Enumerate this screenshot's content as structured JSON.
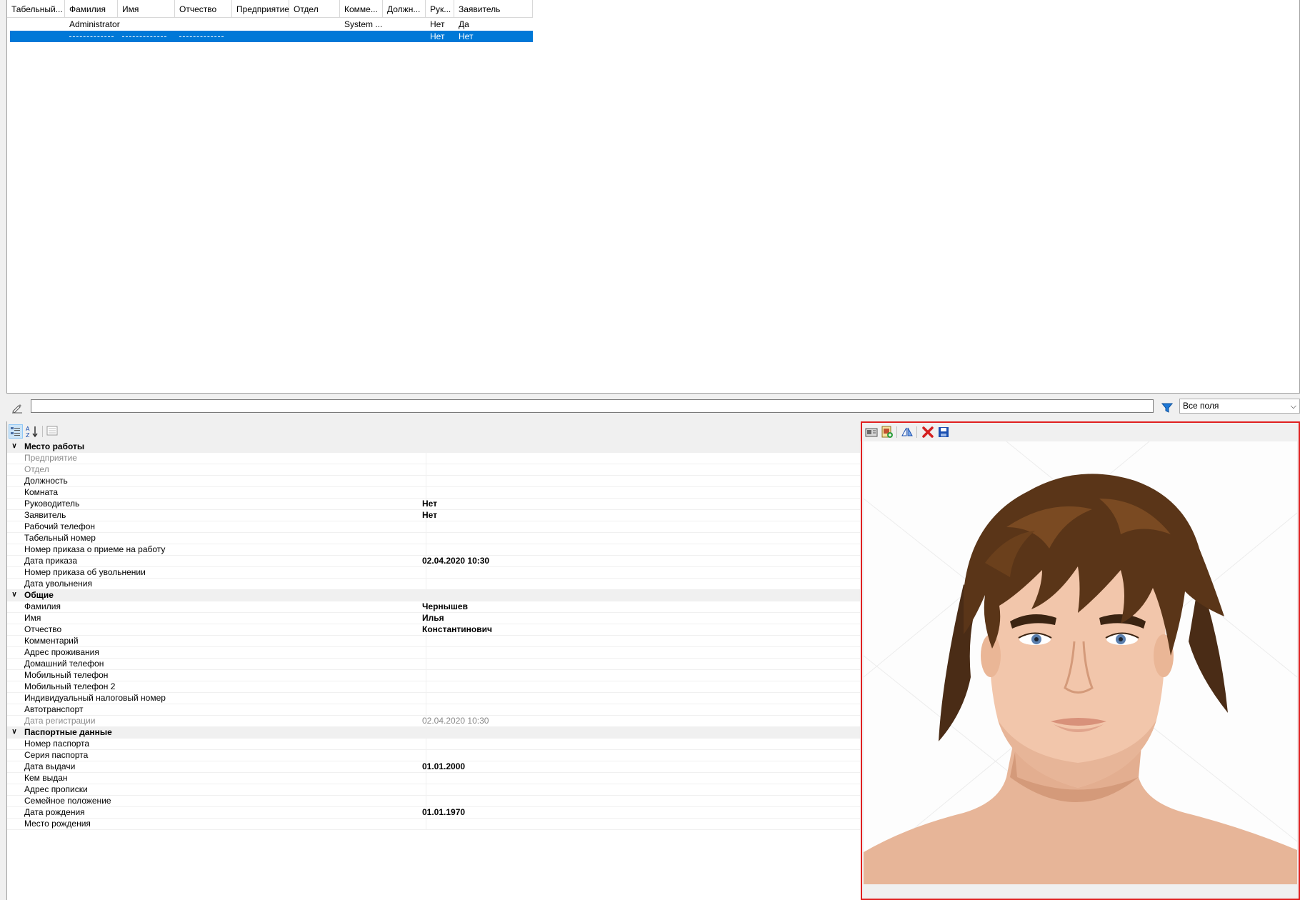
{
  "grid": {
    "columns": [
      "Табельный...",
      "Фамилия",
      "Имя",
      "Отчество",
      "Предприятие",
      "Отдел",
      "Комме...",
      "Должн...",
      "Рук...",
      "Заявитель"
    ],
    "rows": [
      {
        "tabnum": "",
        "lastname": "Administrator",
        "firstname": "",
        "middlename": "",
        "company": "",
        "dept": "",
        "comment": "System ...",
        "position": "",
        "manager": "Нет",
        "applicant": "Да"
      },
      {
        "tabnum": "",
        "lastname": "",
        "firstname": "",
        "middlename": "",
        "company": "",
        "dept": "",
        "comment": "",
        "position": "",
        "manager": "Нет",
        "applicant": "Нет"
      }
    ]
  },
  "search": {
    "value": "",
    "field_select": "Все поля"
  },
  "props": {
    "categories": [
      {
        "title": "Место работы",
        "items": [
          {
            "name": "Предприятие",
            "value": "",
            "disabled": true
          },
          {
            "name": "Отдел",
            "value": "",
            "disabled": true
          },
          {
            "name": "Должность",
            "value": ""
          },
          {
            "name": "Комната",
            "value": ""
          },
          {
            "name": "Руководитель",
            "value": "Нет"
          },
          {
            "name": "Заявитель",
            "value": "Нет"
          },
          {
            "name": "Рабочий телефон",
            "value": ""
          },
          {
            "name": "Табельный номер",
            "value": ""
          },
          {
            "name": "Номер приказа о приеме на работу",
            "value": ""
          },
          {
            "name": "Дата приказа",
            "value": "02.04.2020 10:30"
          },
          {
            "name": "Номер приказа об увольнении",
            "value": ""
          },
          {
            "name": "Дата увольнения",
            "value": ""
          }
        ]
      },
      {
        "title": "Общие",
        "items": [
          {
            "name": "Фамилия",
            "value": "Чернышев"
          },
          {
            "name": "Имя",
            "value": "Илья"
          },
          {
            "name": "Отчество",
            "value": "Константинович"
          },
          {
            "name": "Комментарий",
            "value": ""
          },
          {
            "name": "Адрес проживания",
            "value": ""
          },
          {
            "name": "Домашний телефон",
            "value": ""
          },
          {
            "name": "Мобильный телефон",
            "value": ""
          },
          {
            "name": "Мобильный телефон 2",
            "value": ""
          },
          {
            "name": "Индивидуальный налоговый номер",
            "value": ""
          },
          {
            "name": "Автотранспорт",
            "value": ""
          },
          {
            "name": "Дата регистрации",
            "value": "02.04.2020 10:30",
            "disabled": true
          }
        ]
      },
      {
        "title": "Паспортные данные",
        "items": [
          {
            "name": "Номер паспорта",
            "value": ""
          },
          {
            "name": "Серия паспорта",
            "value": ""
          },
          {
            "name": "Дата выдачи",
            "value": "01.01.2000"
          },
          {
            "name": "Кем выдан",
            "value": ""
          },
          {
            "name": "Адрес прописки",
            "value": ""
          },
          {
            "name": "Семейное положение",
            "value": ""
          },
          {
            "name": "Дата рождения",
            "value": "01.01.1970"
          },
          {
            "name": "Место рождения",
            "value": ""
          }
        ]
      }
    ]
  },
  "icons": {
    "search_bar": [
      "edit-pen-icon",
      "filter-funnel-icon"
    ],
    "props_toolbar": [
      "categorized-view-icon",
      "sort-alphabetical-icon",
      "property-pages-icon"
    ],
    "photo_toolbar": [
      "camera-capture-icon",
      "load-image-icon",
      "mirror-image-icon",
      "delete-icon",
      "save-icon"
    ]
  },
  "colors": {
    "selection": "#0078d7",
    "photo_border": "#e02020",
    "filter": "#1e78d6",
    "delete": "#d42020",
    "save": "#1a4fb0"
  }
}
